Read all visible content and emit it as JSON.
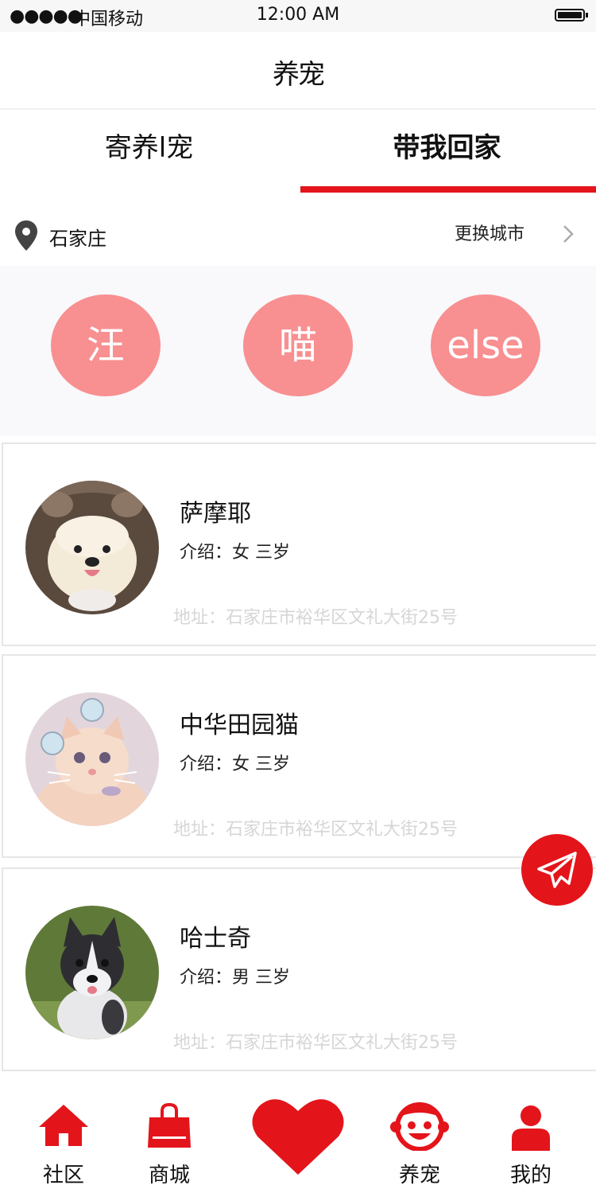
{
  "status_bar": {
    "signal": "●●●●●",
    "carrier": "中国移动",
    "time": "12:00 AM"
  },
  "nav": {
    "title": "养宠"
  },
  "tabs": [
    {
      "label": "寄养l宠",
      "active": false
    },
    {
      "label": "带我回家",
      "active": true
    }
  ],
  "location": {
    "city": "石家庄",
    "change_label": "更换城市"
  },
  "categories": [
    {
      "label": "汪"
    },
    {
      "label": "喵"
    },
    {
      "label": "else"
    }
  ],
  "pets": [
    {
      "name": "萨摩耶",
      "intro": "介绍：女 三岁",
      "address": "地址：石家庄市裕华区文礼大街25号"
    },
    {
      "name": "中华田园猫",
      "intro": "介绍：女 三岁",
      "address": "地址：石家庄市裕华区文礼大街25号"
    },
    {
      "name": "哈士奇",
      "intro": "介绍：男 三岁",
      "address": "地址：石家庄市裕华区文礼大街25号"
    }
  ],
  "tab_bar": [
    {
      "label": "社区",
      "icon": "home-icon"
    },
    {
      "label": "商城",
      "icon": "shopping-bag-icon"
    },
    {
      "label": "",
      "icon": "heart-icon"
    },
    {
      "label": "养宠",
      "icon": "pet-face-icon"
    },
    {
      "label": "我的",
      "icon": "user-icon"
    }
  ],
  "colors": {
    "accent": "#e4141b",
    "category_bubble": "#f88f90",
    "address_text": "#d6d6d6"
  }
}
